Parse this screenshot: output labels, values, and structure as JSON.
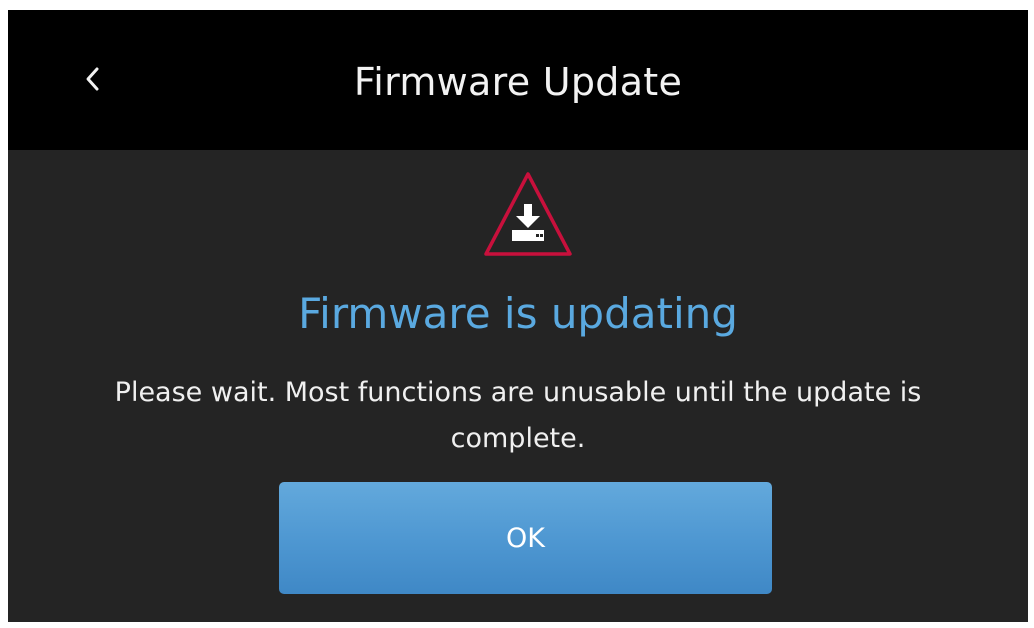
{
  "header": {
    "title": "Firmware Update",
    "back_icon": "chevron-left-icon"
  },
  "status": {
    "icon": "warning-download-icon",
    "title": "Firmware is updating",
    "message": "Please wait. Most functions are unusable until the update is complete."
  },
  "actions": {
    "ok_label": "OK"
  },
  "colors": {
    "background": "#242424",
    "header_background": "#000000",
    "status_title": "#5aa9e0",
    "warning_red": "#c8103c",
    "button_blue": "#4f98d2"
  }
}
